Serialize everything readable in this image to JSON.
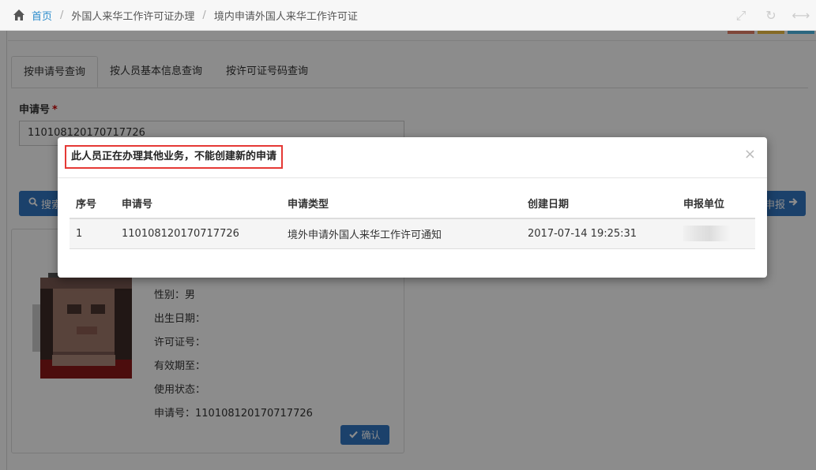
{
  "breadcrumb": {
    "home": "首页",
    "level1": "外国人来华工作许可证办理",
    "level2": "境内申请外国人来华工作许可证"
  },
  "toolbar_icons": [
    "fullscreen-icon",
    "refresh-icon",
    "collapse-icon"
  ],
  "colors": {
    "primary": "#3277c4",
    "link": "#2a8bcc",
    "highlight_border": "#e53935",
    "tool_bar_1": "#e8826b",
    "tool_bar_2": "#f2c144",
    "tool_bar_3": "#4dbbe8"
  },
  "tabs": [
    {
      "label": "按申请号查询",
      "active": true
    },
    {
      "label": "按人员基本信息查询",
      "active": false
    },
    {
      "label": "按许可证号码查询",
      "active": false
    }
  ],
  "form": {
    "app_no_label": "申请号",
    "required_mark": "*",
    "app_no_value": "110108120170717726"
  },
  "buttons": {
    "search": "搜索",
    "report": "申报",
    "confirm": "确认"
  },
  "person_card": {
    "gender": "性别：男",
    "birth_date": "出生日期：",
    "permit_no": "许可证号：",
    "valid_until": "有效期至：",
    "status": "使用状态：",
    "app_no": "申请号：110108120170717726"
  },
  "modal": {
    "title": "此人员正在办理其他业务，不能创建新的申请",
    "close": "×",
    "columns": [
      "序号",
      "申请号",
      "申请类型",
      "创建日期",
      "申报单位"
    ],
    "rows": [
      {
        "index": "1",
        "app_no": "110108120170717726",
        "type": "境外申请外国人来华工作许可通知",
        "created": "2017-07-14 19:25:31",
        "unit": ""
      }
    ]
  }
}
